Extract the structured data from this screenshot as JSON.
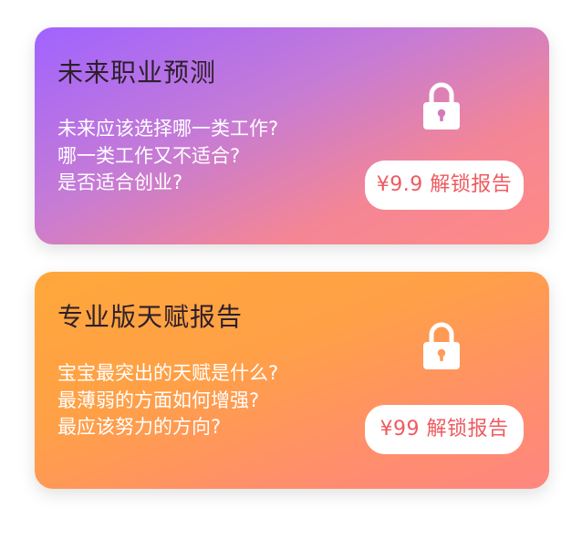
{
  "cards": [
    {
      "title": "未来职业预测",
      "lines": [
        "未来应该选择哪一类工作?",
        "哪一类工作又不适合?",
        "是否适合创业?"
      ],
      "button_label": "¥9.9 解锁报告",
      "icon": "lock-icon"
    },
    {
      "title": "专业版天赋报告",
      "lines": [
        "宝宝最突出的天赋是什么?",
        "最薄弱的方面如何增强?",
        "最应该努力的方向?"
      ],
      "button_label": "¥99 解锁报告",
      "icon": "lock-icon"
    }
  ],
  "colors": {
    "card1_gradient": [
      "#a063ff",
      "#ff8a84"
    ],
    "card2_gradient": [
      "#ffa73a",
      "#ff8680"
    ],
    "button_text": "#ef5a5f",
    "title_text": "#2d1f2a"
  }
}
